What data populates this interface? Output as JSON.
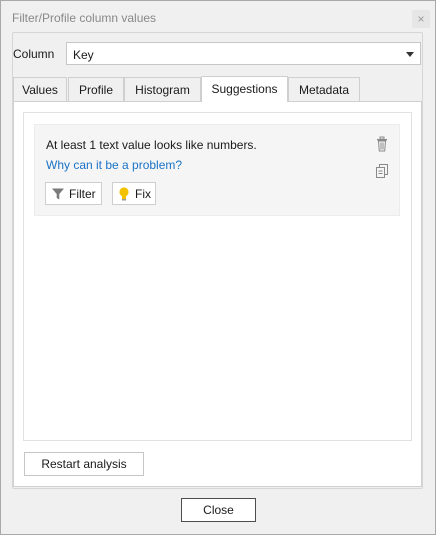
{
  "window": {
    "title": "Filter/Profile column values",
    "close_glyph": "×"
  },
  "column": {
    "label": "Column",
    "selected": "Key"
  },
  "tabs": [
    {
      "label": "Values",
      "active": false
    },
    {
      "label": "Profile",
      "active": false
    },
    {
      "label": "Histogram",
      "active": false
    },
    {
      "label": "Suggestions",
      "active": true
    },
    {
      "label": "Metadata",
      "active": false
    }
  ],
  "suggestion": {
    "text": "At least 1 text value looks like numbers.",
    "link": "Why can it be a problem?",
    "filter_label": "Filter",
    "fix_label": "Fix",
    "icons": [
      "trash-icon",
      "copy-icon",
      "filter-icon",
      "lightbulb-icon"
    ]
  },
  "buttons": {
    "restart": "Restart analysis",
    "close": "Close"
  },
  "colors": {
    "link": "#1a73c7",
    "bulb": "#f2c200"
  }
}
